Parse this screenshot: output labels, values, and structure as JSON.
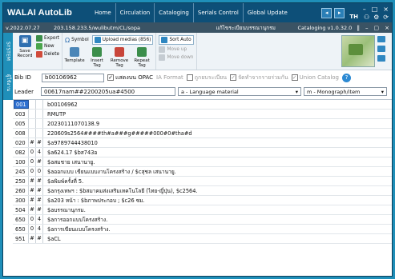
{
  "app": {
    "title": "WALAI AutoLib"
  },
  "nav": {
    "items": [
      {
        "label": "Home"
      },
      {
        "label": "Circulation"
      },
      {
        "label": "Cataloging"
      },
      {
        "label": "Serials Control"
      },
      {
        "label": "Global Update"
      }
    ],
    "lang": "TH",
    "window": {
      "minimize": "–",
      "maximize": "□",
      "close": "×"
    }
  },
  "infobar": {
    "date": "v.2022.07.27",
    "url": "203.158.233.5/wulibutm/CL/sopa",
    "workform": "แก้ไขระเบียนบรรณานุกรม",
    "module": "Cataloging v1.0.32.0",
    "controls": [
      "‖",
      "–",
      "▢",
      "×"
    ]
  },
  "sidetab": {
    "labels": [
      "SYSTEM",
      "ผู้ใช้งาน"
    ]
  },
  "toolbar": {
    "save": "Save Record",
    "export": "Export",
    "new": "New",
    "delete": "Delete",
    "symbol": "Symbol",
    "upload": "Upload medias (856)",
    "template": "Template",
    "insert_tag": "Insert Tag",
    "remove_tag": "Remove Tag",
    "repeat_tag": "Repeat Tag",
    "sort_auto": "Sort Auto",
    "move_up": "Move up",
    "move_down": "Move down"
  },
  "bib": {
    "label": "Bib ID",
    "value": "b00106962",
    "opac_label": "แสดงบน OPAC",
    "opac_checked": true,
    "ia_format": "IA Format",
    "record_owner": "ถูกยบระเบียน",
    "shared": "จัดทำจากรายร่วมกัน",
    "union": "Union Catalog",
    "help": "?"
  },
  "leader": {
    "label": "Leader",
    "value": "00617nam##2200205ua#4500",
    "type": "a - Language material",
    "level": "m - Monograph/item"
  },
  "marc": [
    {
      "tag": "001",
      "i1": "",
      "i2": "",
      "value": "b00106962"
    },
    {
      "tag": "003",
      "i1": "",
      "i2": "",
      "value": "RMUTP"
    },
    {
      "tag": "005",
      "i1": "",
      "i2": "",
      "value": "20230111070138.9"
    },
    {
      "tag": "008",
      "i1": "",
      "i2": "",
      "value": "220609s2564####th#a###g#####000#0#tha#d"
    },
    {
      "tag": "020",
      "i1": "#",
      "i2": "#",
      "value": "$a9789744438010"
    },
    {
      "tag": "082",
      "i1": "0",
      "i2": "4",
      "value": "$a624.17 $bส743อ"
    },
    {
      "tag": "100",
      "i1": "0",
      "i2": "#",
      "value": "$aสมชาย เสนานายู."
    },
    {
      "tag": "245",
      "i1": "0",
      "i2": "0",
      "value": "$aออกแบบ เขียนแบบงานโครงสร้าง / $cสุชล เสนานายู."
    },
    {
      "tag": "250",
      "i1": "#",
      "i2": "#",
      "value": "$aพิมพ์ครั้งที่ 5."
    },
    {
      "tag": "260",
      "i1": "#",
      "i2": "#",
      "value": "$aกรุงเทพฯ : $bสมาคมส่งเสริมเทคโนโลยี (ไทย-ญี่ปุ่น), $c2564."
    },
    {
      "tag": "300",
      "i1": "#",
      "i2": "#",
      "value": "$a203 หน้า : $bภาพประกอบ ; $c26 ซม."
    },
    {
      "tag": "504",
      "i1": "#",
      "i2": "#",
      "value": "$aบรรณานุกรม."
    },
    {
      "tag": "650",
      "i1": "0",
      "i2": "4",
      "value": "$aการออกแบบโครงสร้าง."
    },
    {
      "tag": "650",
      "i1": "0",
      "i2": "4",
      "value": "$aการเขียนแบบโครงสร้าง."
    },
    {
      "tag": "951",
      "i1": "#",
      "i2": "#",
      "value": "$aCL"
    }
  ],
  "colors": {
    "accent": "#0d4f78",
    "selection": "#2d6fd0",
    "frame": "#1f8fb9"
  }
}
